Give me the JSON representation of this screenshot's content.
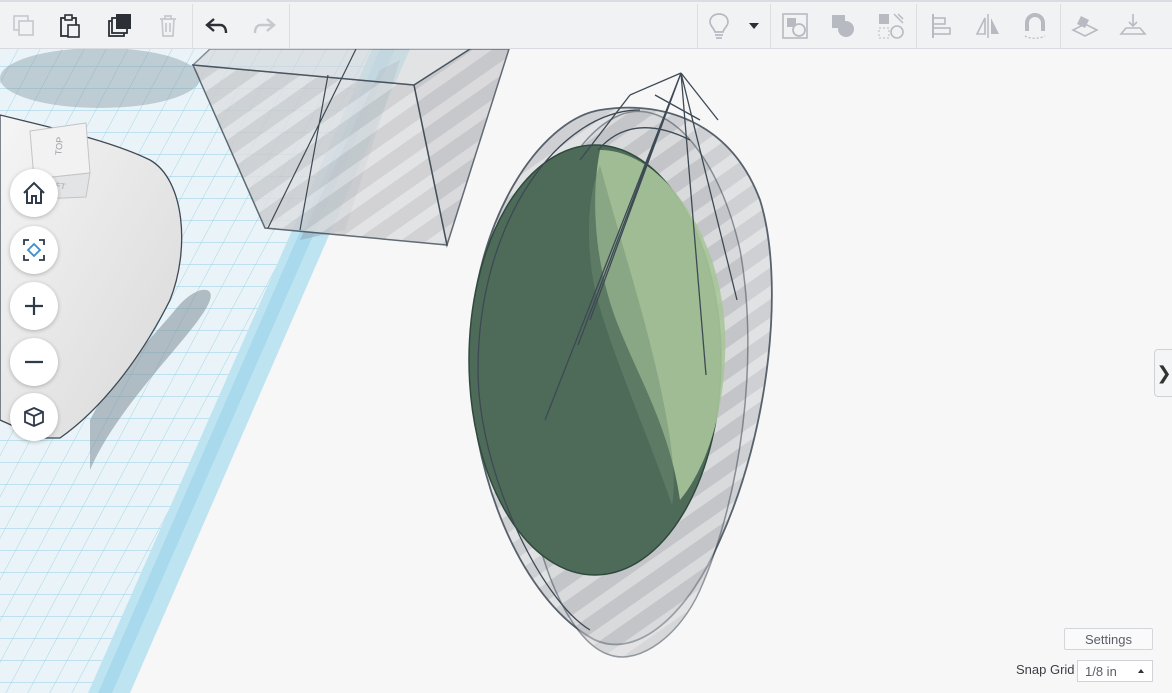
{
  "toolbar": {
    "left_tools": [
      {
        "icon": "copy-icon",
        "enabled": false
      },
      {
        "icon": "paste-icon",
        "enabled": true
      },
      {
        "icon": "duplicate-icon",
        "enabled": true
      },
      {
        "icon": "trash-icon",
        "enabled": false
      },
      {
        "icon": "undo-icon",
        "enabled": true
      },
      {
        "icon": "redo-icon",
        "enabled": false
      }
    ],
    "right_tools": [
      {
        "icon": "lightbulb-icon"
      },
      {
        "icon": "chevron-down-icon"
      },
      {
        "icon": "group-icon"
      },
      {
        "icon": "ungroup-icon"
      },
      {
        "icon": "hole-solid-icon"
      },
      {
        "icon": "align-icon"
      },
      {
        "icon": "mirror-icon"
      },
      {
        "icon": "magnet-icon"
      },
      {
        "icon": "workplane-icon"
      },
      {
        "icon": "ruler-icon"
      }
    ]
  },
  "viewcube": {
    "top_label": "TOP",
    "left_label": "LEFT"
  },
  "nav": [
    {
      "icon": "home-icon"
    },
    {
      "icon": "fit-view-icon"
    },
    {
      "icon": "zoom-in-icon"
    },
    {
      "icon": "zoom-out-icon"
    },
    {
      "icon": "perspective-icon"
    }
  ],
  "settings": {
    "label": "Settings"
  },
  "snap_grid": {
    "label": "Snap Grid",
    "value": "1/8 in"
  },
  "colors": {
    "accent_green": "#4e6b5a",
    "light_green": "#a9c59a",
    "grid_blue": "#bfe4f1"
  }
}
